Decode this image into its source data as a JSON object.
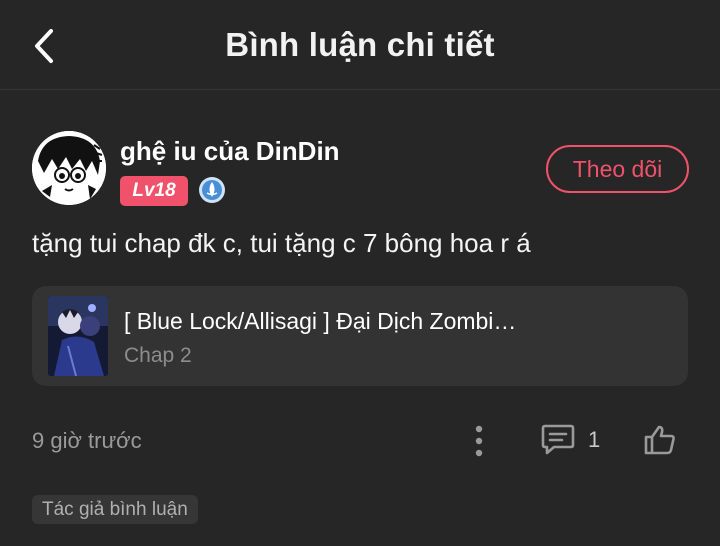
{
  "header": {
    "title": "Bình luận chi tiết",
    "back_icon": "chevron-left-icon"
  },
  "comment": {
    "username": "ghệ iu của DinDin",
    "level": "Lv18",
    "follow_label": "Theo dõi",
    "text": "tặng tui chap đk c, tui tặng c 7 bông hoa r á",
    "timestamp": "9 giờ trước",
    "reply_count": "1",
    "author_tag": "Tác giả bình luận"
  },
  "story": {
    "title": "[ Blue Lock/Allisagi ] Đại Dịch Zombi…",
    "chapter": "Chap 2"
  },
  "colors": {
    "background": "#262626",
    "accent": "#f0516b",
    "card": "#333333",
    "muted_text": "#9a9a9a",
    "rank_badge": "#4a8fd6"
  }
}
